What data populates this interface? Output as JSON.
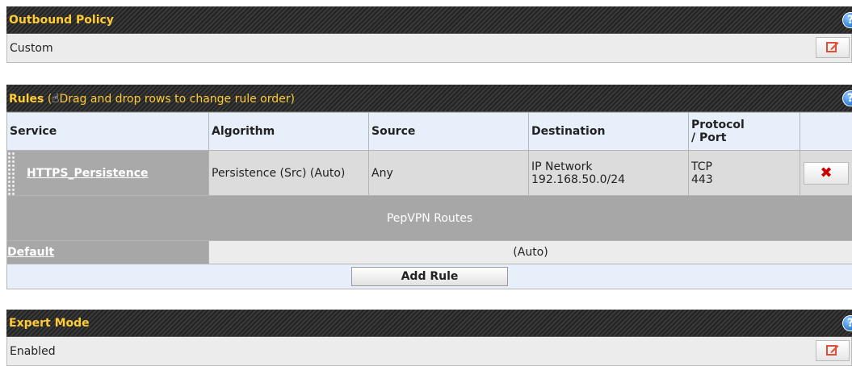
{
  "outbound": {
    "title": "Outbound Policy",
    "value": "Custom",
    "edit_icon": "edit-icon",
    "help_icon": "help-icon",
    "help_symbol": "?"
  },
  "rules": {
    "title": "Rules",
    "subtitle_open": " (",
    "hand_icon": "hand-icon",
    "subtitle": "Drag and drop rows to change rule order)",
    "help_symbol": "?",
    "columns": [
      "Service",
      "Algorithm",
      "Source",
      "Destination",
      "Protocol / Port",
      ""
    ],
    "rows": [
      {
        "service": "HTTPS_Persistence",
        "algorithm": "Persistence (Src) (Auto)",
        "source": "Any",
        "destination_line1": "IP Network",
        "destination_line2": "192.168.50.0/24",
        "protocol": "TCP",
        "port": "443",
        "delete_symbol": "✖"
      }
    ],
    "pepvpn_label": "PepVPN Routes",
    "default_label": "Default",
    "default_value": "(Auto)",
    "add_rule_label": "Add Rule"
  },
  "expert": {
    "title": "Expert Mode",
    "value": "Enabled",
    "help_symbol": "?"
  },
  "colors": {
    "header_text": "#ffcc33",
    "header_bg": "#2b2b2b",
    "column_header_bg": "#e6effa",
    "delete_icon": "#cc0000",
    "edit_icon": "#e04e39"
  }
}
